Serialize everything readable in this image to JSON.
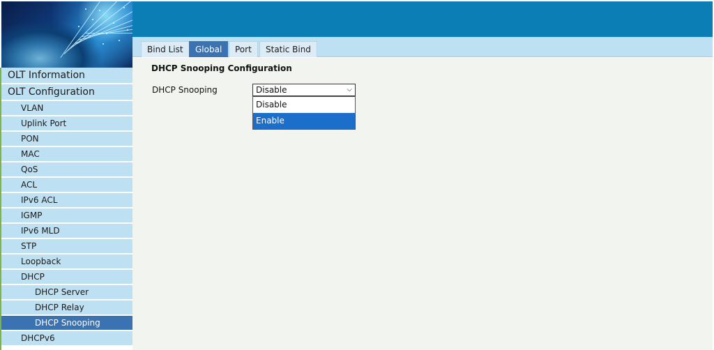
{
  "tabs": [
    {
      "label": "Bind List",
      "active": false
    },
    {
      "label": "Global",
      "active": true
    },
    {
      "label": "Port",
      "active": false
    },
    {
      "label": "Static Bind",
      "active": false
    }
  ],
  "main": {
    "title": "DHCP Snooping Configuration",
    "field_label": "DHCP Snooping",
    "select_value": "Disable",
    "options": [
      "Disable",
      "Enable"
    ],
    "highlighted_option": "Enable"
  },
  "sidebar": {
    "items": [
      {
        "label": "OLT Information",
        "level": 0
      },
      {
        "label": "OLT Configuration",
        "level": 0
      },
      {
        "label": "VLAN",
        "level": 1
      },
      {
        "label": "Uplink Port",
        "level": 1
      },
      {
        "label": "PON",
        "level": 1
      },
      {
        "label": "MAC",
        "level": 1
      },
      {
        "label": "QoS",
        "level": 1
      },
      {
        "label": "ACL",
        "level": 1
      },
      {
        "label": "IPv6 ACL",
        "level": 1
      },
      {
        "label": "IGMP",
        "level": 1
      },
      {
        "label": "IPv6 MLD",
        "level": 1
      },
      {
        "label": "STP",
        "level": 1
      },
      {
        "label": "Loopback",
        "level": 1
      },
      {
        "label": "DHCP",
        "level": 1
      },
      {
        "label": "DHCP Server",
        "level": 2
      },
      {
        "label": "DHCP Relay",
        "level": 2
      },
      {
        "label": "DHCP Snooping",
        "level": 2,
        "active": true
      },
      {
        "label": "DHCPv6",
        "level": 1
      }
    ]
  },
  "colors": {
    "topbar": "#0a7eb5",
    "nav_bg": "#bde0f2",
    "active": "#3a72b2",
    "option_highlight": "#1b6ec9"
  }
}
